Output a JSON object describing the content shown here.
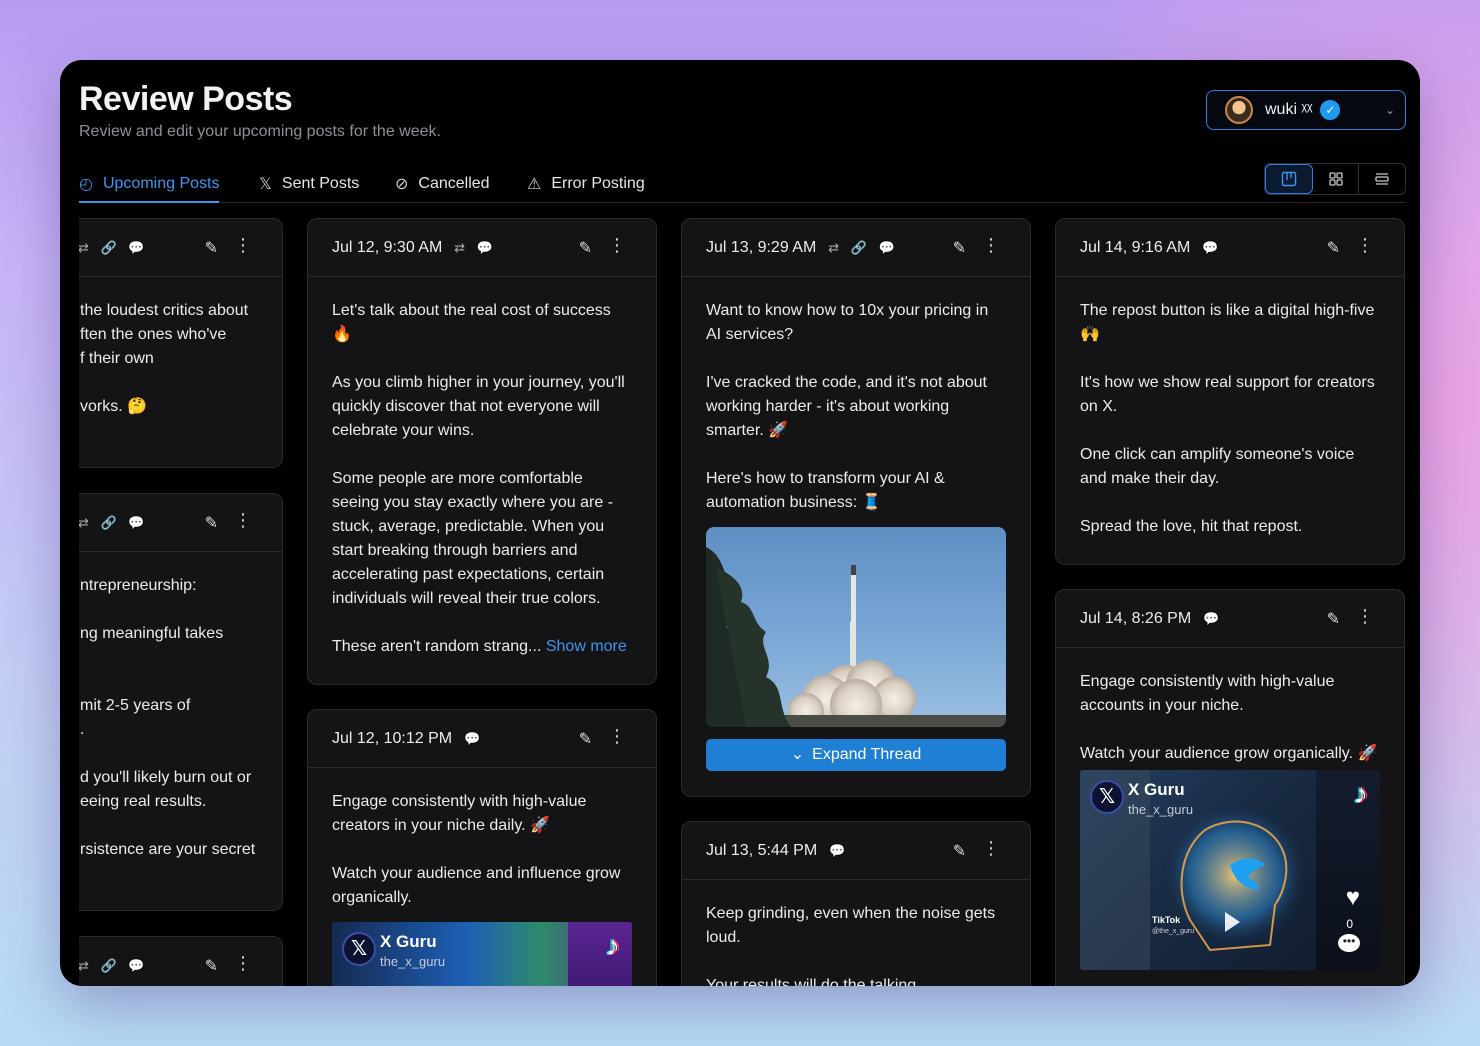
{
  "header": {
    "title": "Review Posts",
    "subtitle": "Review and edit your upcoming posts for the week."
  },
  "account": {
    "name": "wuki ᵡᵡ",
    "verified_icon": "verified-check-icon",
    "chevron_icon": "chevron-down-icon"
  },
  "tabs": [
    {
      "label": "Upcoming Posts",
      "icon": "clock-icon",
      "active": true
    },
    {
      "label": "Sent Posts",
      "icon": "x-logo-icon",
      "active": false
    },
    {
      "label": "Cancelled",
      "icon": "cancel-icon",
      "active": false
    },
    {
      "label": "Error Posting",
      "icon": "warning-icon",
      "active": false
    }
  ],
  "view_modes": [
    "kanban",
    "grid",
    "list"
  ],
  "colors": {
    "accent": "#3d95ee",
    "button": "#1f7fd4",
    "card_bg": "#141416",
    "window_bg": "#000000"
  },
  "columns": [
    {
      "cards": [
        {
          "date": "",
          "icons": "⇄ 🔗 💬",
          "lines": [
            "the loudest critics about",
            "ften the ones who've",
            "f their own",
            "",
            "vorks. 🤔"
          ]
        },
        {
          "date": "",
          "icons": "⇄ 🔗 💬",
          "lines": [
            "ntrepreneurship:",
            "",
            "ng meaningful takes",
            "",
            "",
            "mit 2-5 years of",
            ".",
            "",
            "d you'll likely burn out or",
            "eeing real results.",
            "",
            "rsistence are your secret"
          ]
        },
        {
          "date": "",
          "icons": "⇄ 🔗 💬",
          "lines": []
        }
      ]
    },
    {
      "cards": [
        {
          "date": "Jul 12, 9:30 AM",
          "icons": "⇄ 💬",
          "paragraphs": [
            "Let's talk about the real cost of success 🔥",
            "As you climb higher in your journey, you'll quickly discover that not everyone will celebrate your wins.",
            "Some people are more comfortable seeing you stay exactly where you are - stuck, average, predictable. When you start breaking through barriers and accelerating past expectations, certain individuals will reveal their true colors."
          ],
          "truncated": "These aren't random strang...",
          "show_more": "Show more"
        },
        {
          "date": "Jul 12, 10:12 PM",
          "icons": "💬",
          "paragraphs": [
            "Engage consistently with high-value creators in your niche daily. 🚀",
            "Watch your audience and influence grow organically."
          ],
          "media": {
            "name": "X Guru",
            "handle": "the_x_guru"
          }
        }
      ]
    },
    {
      "cards": [
        {
          "date": "Jul 13, 9:29 AM",
          "icons": "⇄ 🔗 💬",
          "paragraphs": [
            "Want to know how to 10x your pricing in AI services?",
            "I've cracked the code, and it's not about working harder - it's about working smarter. 🚀",
            "Here's how to transform your AI & automation business: 🧵"
          ],
          "image": "rocket-launch-image",
          "button": "Expand Thread"
        },
        {
          "date": "Jul 13, 5:44 PM",
          "icons": "💬",
          "paragraphs": [
            "Keep grinding, even when the noise gets loud.",
            "Your results will do the talking."
          ]
        }
      ]
    },
    {
      "cards": [
        {
          "date": "Jul 14, 9:16 AM",
          "icons": "💬",
          "paragraphs": [
            "The repost button is like a digital high-five 🙌",
            "It's how we show real support for creators on X.",
            "One click can amplify someone's voice and make their day.",
            "Spread the love, hit that repost."
          ]
        },
        {
          "date": "Jul 14, 8:26 PM",
          "icons": "💬",
          "paragraphs": [
            "Engage consistently with high-value accounts in your niche.",
            "Watch your audience grow organically. 🚀"
          ],
          "media": {
            "name": "X Guru",
            "handle": "the_x_guru",
            "likes": "0",
            "watermark": "TikTok",
            "watermark_handle": "@the_x_guru"
          }
        }
      ]
    }
  ]
}
